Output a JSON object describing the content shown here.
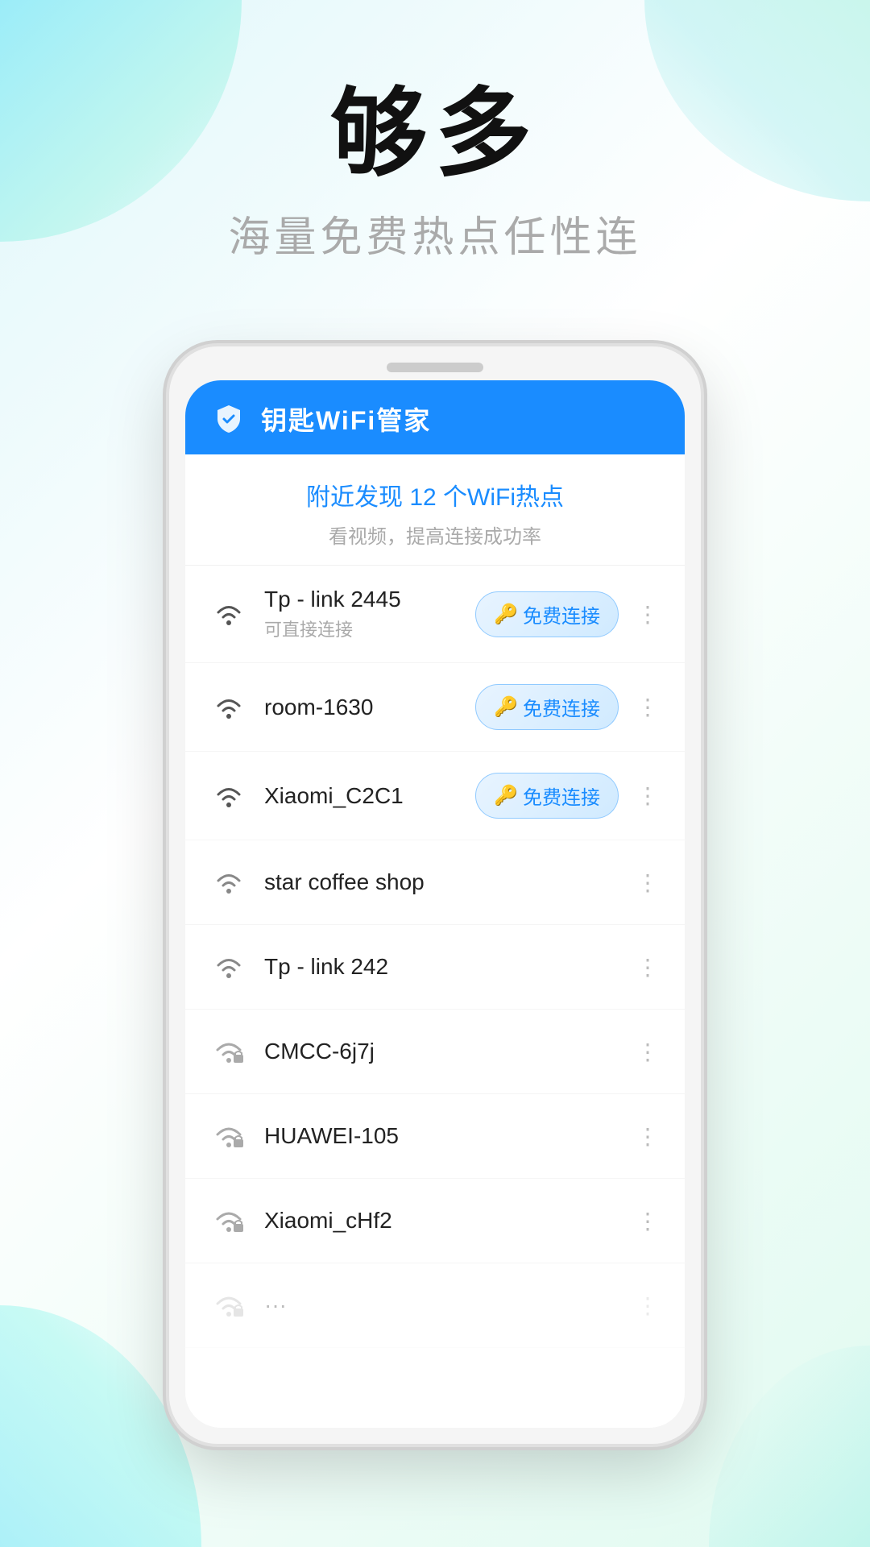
{
  "hero": {
    "title": "够多",
    "subtitle": "海量免费热点任性连"
  },
  "app": {
    "header": {
      "title": "钥匙WiFi管家"
    },
    "discovery": {
      "count_text": "附近发现 12 个WiFi热点",
      "hint_text": "看视频，提高连接成功率"
    },
    "wifi_list": [
      {
        "name": "Tp - link 2445",
        "sub": "可直接连接",
        "locked": false,
        "has_button": true,
        "button_label": "免费连接"
      },
      {
        "name": "room-1630",
        "sub": "",
        "locked": false,
        "has_button": true,
        "button_label": "免费连接"
      },
      {
        "name": "Xiaomi_C2C1",
        "sub": "",
        "locked": false,
        "has_button": true,
        "button_label": "免费连接"
      },
      {
        "name": "star coffee shop",
        "sub": "",
        "locked": false,
        "has_button": false,
        "button_label": ""
      },
      {
        "name": "Tp - link 242",
        "sub": "",
        "locked": false,
        "has_button": false,
        "button_label": ""
      },
      {
        "name": "CMCC-6j7j",
        "sub": "",
        "locked": true,
        "has_button": false,
        "button_label": ""
      },
      {
        "name": "HUAWEI-105",
        "sub": "",
        "locked": true,
        "has_button": false,
        "button_label": ""
      },
      {
        "name": "Xiaomi_cHf2",
        "sub": "",
        "locked": true,
        "has_button": false,
        "button_label": ""
      },
      {
        "name": "...",
        "sub": "",
        "locked": true,
        "has_button": false,
        "button_label": ""
      }
    ],
    "more_icon": "⋮",
    "key_icon": "🔑"
  },
  "colors": {
    "brand_blue": "#1a8cff",
    "text_dark": "#222222",
    "text_gray": "#aaaaaa"
  }
}
